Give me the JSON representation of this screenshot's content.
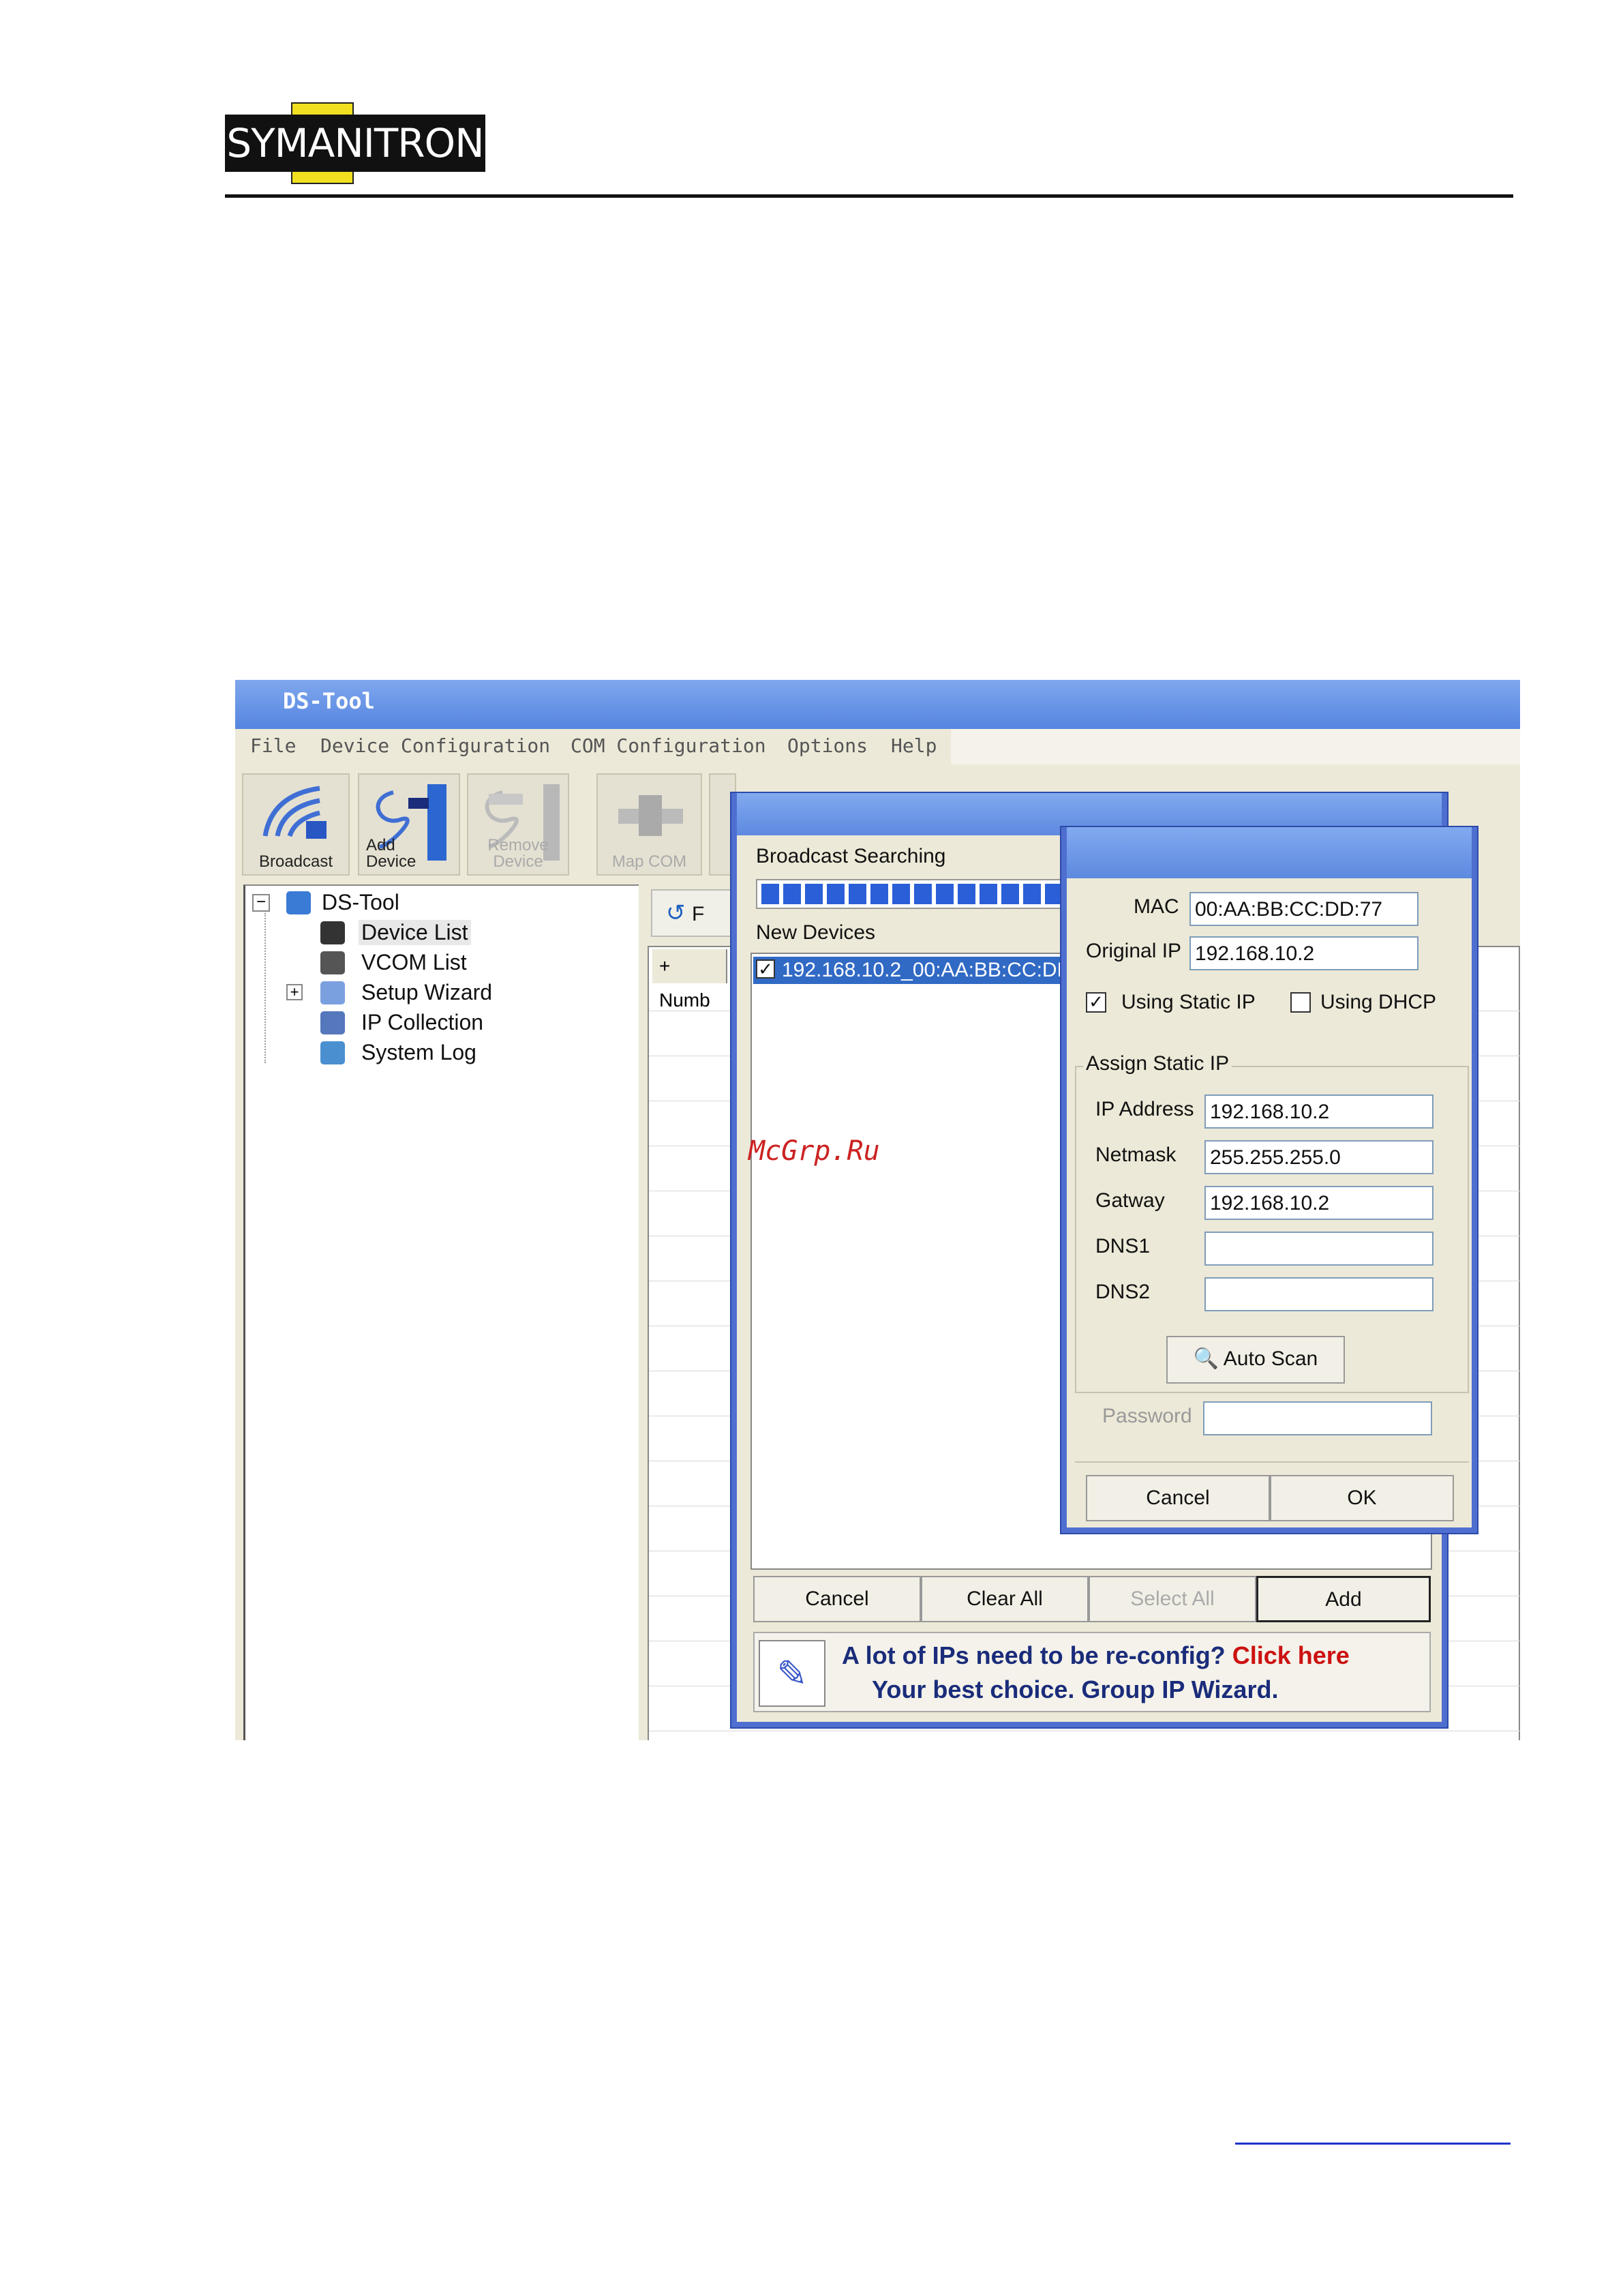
{
  "brand": {
    "logo_text": "SYMANITRON"
  },
  "window": {
    "title": "DS-Tool",
    "menu": [
      "File",
      "Device Configuration",
      "COM Configuration",
      "Options",
      "Help"
    ],
    "toolbar": {
      "broadcast": "Broadcast",
      "add_device": "Add Device",
      "remove_device": "Remove Device",
      "map_com": "Map COM"
    },
    "tree": {
      "root": "DS-Tool",
      "items": [
        "Device List",
        "VCOM List",
        "Setup Wizard",
        "IP Collection",
        "System Log"
      ]
    },
    "list": {
      "refresh_label": "F",
      "column_header": "+ Numb"
    }
  },
  "broadcast_dialog": {
    "status": "Broadcast Searching",
    "progress_fraction": 0.7,
    "new_devices_label": "New Devices",
    "device_row": "192.168.10.2_00:AA:BB:CC:DD:",
    "buttons": {
      "cancel": "Cancel",
      "clear_all": "Clear All",
      "select_all": "Select All",
      "add": "Add"
    },
    "banner": {
      "line1": "A lot of IPs need to be re-config?",
      "link": "Click here",
      "line2": "Your best choice. Group IP Wizard."
    }
  },
  "ip_dialog": {
    "mac_label": "MAC",
    "mac_value": "00:AA:BB:CC:DD:77",
    "original_ip_label": "Original IP",
    "original_ip_value": "192.168.10.2",
    "static_ip_label": "Using Static IP",
    "dhcp_label": "Using DHCP",
    "group_title": "Assign Static IP",
    "ip_address_label": "IP Address",
    "ip_address_value": "192.168.10.2",
    "netmask_label": "Netmask",
    "netmask_value": "255.255.255.0",
    "gateway_label": "Gatway",
    "gateway_value": "192.168.10.2",
    "dns1_label": "DNS1",
    "dns1_value": "",
    "dns2_label": "DNS2",
    "dns2_value": "",
    "auto_scan": "Auto Scan",
    "password_label": "Password",
    "password_value": "",
    "cancel": "Cancel",
    "ok": "OK"
  },
  "watermark": "McGrp.Ru"
}
